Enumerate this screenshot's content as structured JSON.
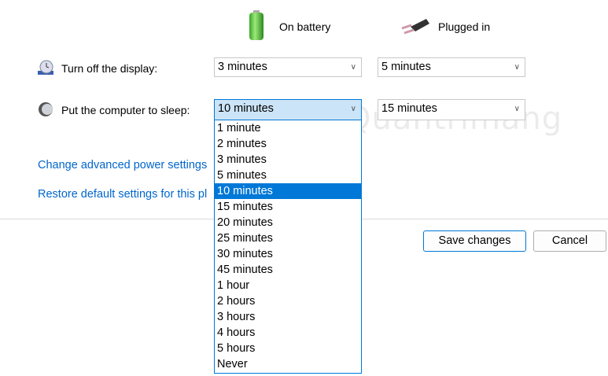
{
  "columns": {
    "battery": "On battery",
    "plugged": "Plugged in"
  },
  "rows": [
    {
      "label": "Turn off the display:",
      "battery": "3 minutes",
      "plugged": "5 minutes"
    },
    {
      "label": "Put the computer to sleep:",
      "battery": "10 minutes",
      "plugged": "15 minutes"
    }
  ],
  "dropdown_options": [
    "1 minute",
    "2 minutes",
    "3 minutes",
    "5 minutes",
    "10 minutes",
    "15 minutes",
    "20 minutes",
    "25 minutes",
    "30 minutes",
    "45 minutes",
    "1 hour",
    "2 hours",
    "3 hours",
    "4 hours",
    "5 hours",
    "Never"
  ],
  "selected_index": 4,
  "links": {
    "advanced": "Change advanced power settings",
    "restore": "Restore default settings for this pl"
  },
  "buttons": {
    "save": "Save changes",
    "cancel": "Cancel"
  },
  "watermark": "Quantrimang"
}
